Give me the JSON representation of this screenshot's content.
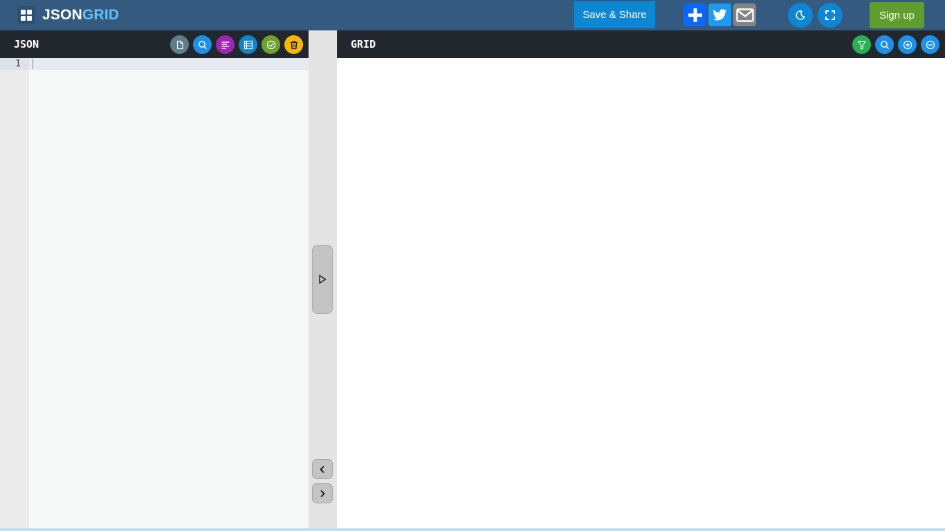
{
  "topbar": {
    "brand_part1": "JSON",
    "brand_part2": "GRID",
    "save_share_label": "Save & Share",
    "signup_label": "Sign up",
    "icons": [
      "apps-grid-icon",
      "plus-icon",
      "twitter-icon",
      "email-icon",
      "moon-icon",
      "fullscreen-icon"
    ]
  },
  "json_panel": {
    "title": "JSON",
    "tools": [
      "new-file",
      "search",
      "format",
      "tree-view",
      "validate",
      "delete"
    ],
    "tool_colors": [
      "#607d8b",
      "#1e90e8",
      "#9c27b0",
      "#0b86c9",
      "#6ea22f",
      "#f6b800"
    ],
    "line_numbers": [
      "1"
    ]
  },
  "grid_panel": {
    "title": "GRID",
    "tools": [
      "filter",
      "search",
      "expand-all",
      "collapse-all"
    ],
    "tool_colors": [
      "#27b050",
      "#1e90e8",
      "#1e90e8",
      "#1e90e8"
    ]
  },
  "colors": {
    "topbar": "#345a80",
    "header": "#22272d",
    "save_share": "#0d86d3",
    "signup": "#5f9d2e",
    "brand_accent": "#62c1f7"
  }
}
